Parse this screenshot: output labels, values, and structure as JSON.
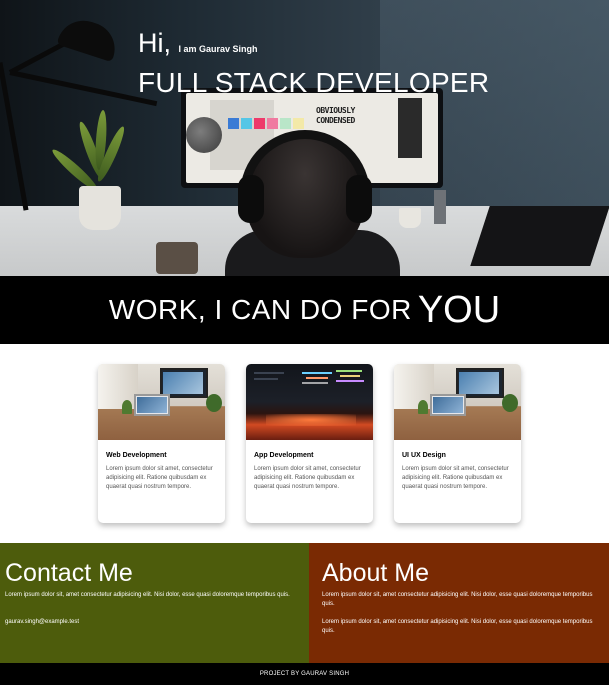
{
  "hero": {
    "greeting_large": "Hi,",
    "greeting_small": "I am Gaurav Singh",
    "title": "FULL STACK DEVELOPER",
    "screen_text": "OBVIOUSLY CONDENSED"
  },
  "banner": {
    "text": "WORK, I CAN DO FOR",
    "emphasis": "YOU"
  },
  "services": [
    {
      "title": "Web Development",
      "description": "Lorem ipsum dolor sit amet, consectetur adipisicing elit. Ratione quibusdam ex quaerat quasi nostrum tempore.",
      "image": "desk-workspace-photo"
    },
    {
      "title": "App Development",
      "description": "Lorem ipsum dolor sit amet, consectetur adipisicing elit. Ratione quibusdam ex quaerat quasi nostrum tempore.",
      "image": "code-screen-photo"
    },
    {
      "title": "UI UX Design",
      "description": "Lorem ipsum dolor sit amet, consectetur adipisicing elit. Ratione quibusdam ex quaerat quasi nostrum tempore.",
      "image": "desk-workspace-photo"
    }
  ],
  "contact": {
    "title": "Contact Me",
    "text": "Lorem ipsum dolor sit, amet consectetur adipisicing elit. Nisi dolor, esse quasi doloremque temporibus quis.",
    "email": "gaurav.singh@example.test",
    "background": "#4d5c0c"
  },
  "about": {
    "title": "About Me",
    "paragraph1": "Lorem ipsum dolor sit, amet consectetur adipisicing elit. Nisi dolor, esse quasi doloremque temporibus quis.",
    "paragraph2": "Lorem ipsum dolor sit, amet consectetur adipisicing elit. Nisi dolor, esse quasi doloremque temporibus quis.",
    "background": "#7a2a03"
  },
  "footer": {
    "text": "PROJECT BY GAURAV SINGH"
  }
}
